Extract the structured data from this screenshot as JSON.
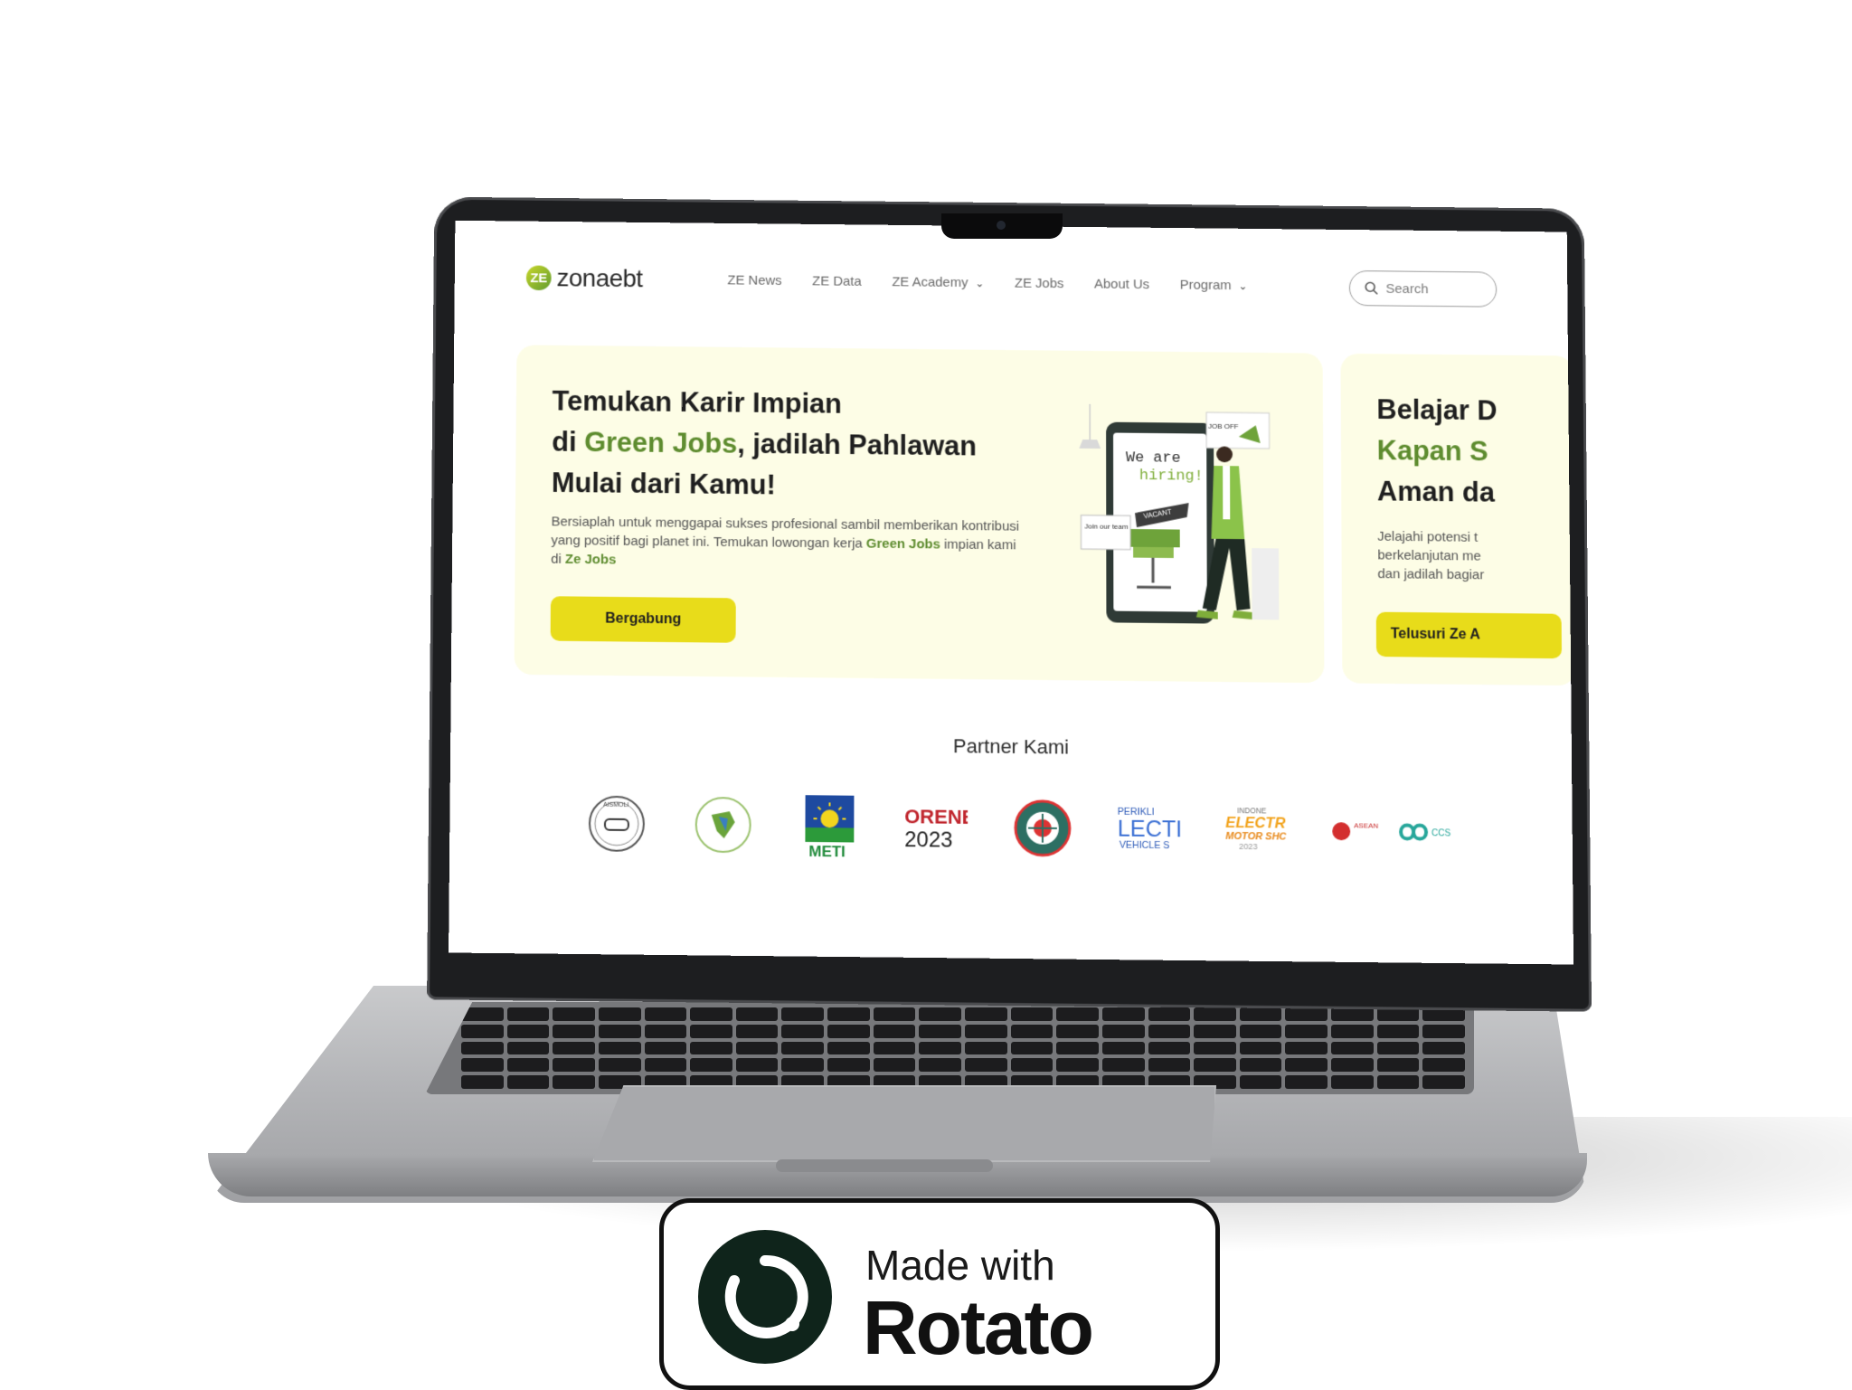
{
  "brand": {
    "name": "zonaebt",
    "mark": "ZE"
  },
  "nav": {
    "items": [
      {
        "label": "ZE News",
        "has_dropdown": false
      },
      {
        "label": "ZE Data",
        "has_dropdown": false
      },
      {
        "label": "ZE Academy",
        "has_dropdown": true
      },
      {
        "label": "ZE Jobs",
        "has_dropdown": false
      },
      {
        "label": "About Us",
        "has_dropdown": false
      },
      {
        "label": "Program",
        "has_dropdown": true
      }
    ],
    "search_placeholder": "Search"
  },
  "hero": {
    "cards": [
      {
        "title_line1": "Temukan Karir Impian",
        "title_line2_prefix": "di ",
        "title_line2_highlight": "Green Jobs",
        "title_line2_suffix": ", jadilah Pahlawan",
        "title_line3": "Mulai dari Kamu!",
        "desc_part1": "Bersiaplah untuk menggapai sukses profesional sambil memberikan kontribusi yang positif bagi planet ini. Temukan lowongan kerja ",
        "desc_highlight1": "Green Jobs",
        "desc_part2": " impian kami di ",
        "desc_highlight2": "Ze Jobs",
        "button": "Bergabung",
        "illustration": {
          "screen_text1": "We are",
          "screen_text2": "hiring!",
          "tag1": "JOB OFF",
          "tag2": "VACANT",
          "small_card": "Join our team"
        }
      },
      {
        "title_line1": "Belajar D",
        "title_line2_highlight": "Kapan S",
        "title_line3": "Aman da",
        "desc_line1": "Jelajahi potensi t",
        "desc_line2": "berkelanjutan me",
        "desc_line3": "dan jadilah bagiar",
        "button": "Telusuri Ze A"
      }
    ]
  },
  "partners": {
    "title": "Partner Kami",
    "logos": [
      {
        "name": "aismoli-logo",
        "text": "AISMOLI"
      },
      {
        "name": "apei-logo",
        "text": ""
      },
      {
        "name": "meti-logo",
        "text": "METI"
      },
      {
        "name": "orenergy-logo",
        "text_top": "ORENE",
        "text_bottom": "2023"
      },
      {
        "name": "seal-logo",
        "text": ""
      },
      {
        "name": "periklindo-logo",
        "text_top": "PERIKLI",
        "text_mid": "LECTI",
        "text_bottom": "VEHICLE S"
      },
      {
        "name": "indonesia-electric-motor-show-logo",
        "text_top": "INDONE",
        "text_mid": "ELECTR",
        "text_mid2": "MOTOR SHC",
        "text_bottom": "2023"
      },
      {
        "name": "asean-ccs-logo",
        "text": "ASEAN",
        "text2": "CCS"
      }
    ]
  },
  "badge": {
    "line1": "Made with",
    "line2": "Rotato"
  },
  "colors": {
    "accent_green": "#5e8c2f",
    "button_yellow": "#e8dc1a",
    "card_bg": "#fdfde6"
  }
}
